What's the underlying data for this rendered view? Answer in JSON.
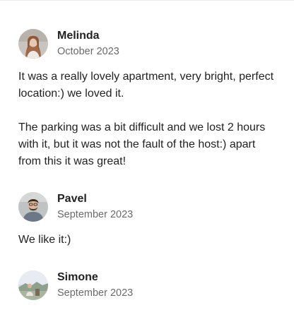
{
  "reviews": [
    {
      "name": "Melinda",
      "date": "October 2023",
      "avatar_icon": "avatar-woman-icon",
      "paragraphs": [
        "It was a really lovely apartment, very bright, perfect location:) we loved it.",
        "The parking was a bit difficult and we lost 2 hours with it, but it was not the fault of the host:) apart from this it was great!"
      ]
    },
    {
      "name": "Pavel",
      "date": "September 2023",
      "avatar_icon": "avatar-man-icon",
      "paragraphs": [
        "We like it:)"
      ]
    },
    {
      "name": "Simone",
      "date": "September 2023",
      "avatar_icon": "avatar-landscape-icon",
      "paragraphs": []
    }
  ],
  "colors": {
    "text_primary": "#222222",
    "text_secondary": "#6a6a6a",
    "divider": "#ebebeb"
  }
}
